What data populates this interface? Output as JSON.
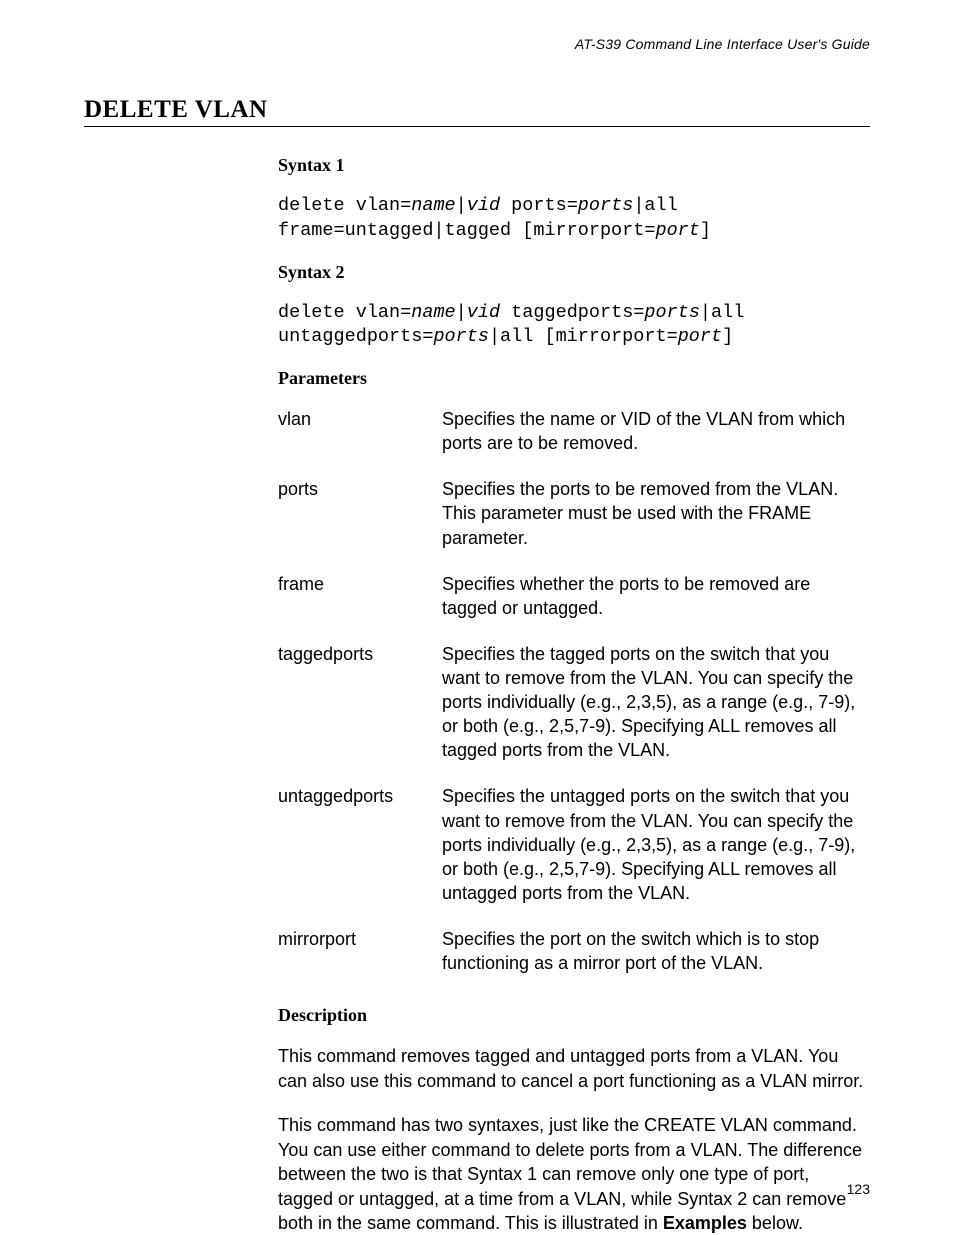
{
  "running_head": "AT-S39 Command Line Interface User's Guide",
  "title": "DELETE VLAN",
  "sections": {
    "syntax1_head": "Syntax 1",
    "syntax2_head": "Syntax 2",
    "params_head": "Parameters",
    "desc_head": "Description"
  },
  "syntax1": {
    "l1a": "delete vlan=",
    "l1b": "name",
    "l1c": "|",
    "l1d": "vid",
    "l1e": " ports=",
    "l1f": "ports",
    "l1g": "|all",
    "l2a": "frame=untagged|tagged [mirrorport=",
    "l2b": "port",
    "l2c": "]"
  },
  "syntax2": {
    "l1a": "delete vlan=",
    "l1b": "name",
    "l1c": "|",
    "l1d": "vid",
    "l1e": " taggedports=",
    "l1f": "ports",
    "l1g": "|all",
    "l2a": "untaggedports=",
    "l2b": "ports",
    "l2c": "|all [mirrorport=",
    "l2d": "port",
    "l2e": "]"
  },
  "parameters": {
    "p0": {
      "name": "vlan",
      "desc": "Specifies the name or VID of the VLAN from which ports are to be removed."
    },
    "p1": {
      "name": "ports",
      "desc": "Specifies the ports to be removed from the VLAN. This parameter must be used with the FRAME parameter."
    },
    "p2": {
      "name": "frame",
      "desc": "Specifies whether the ports to be removed are tagged or untagged."
    },
    "p3": {
      "name": "taggedports",
      "desc": "Specifies the tagged ports on the switch that you want to remove from the VLAN. You can specify the ports individually (e.g., 2,3,5), as a range (e.g., 7-9), or both (e.g., 2,5,7-9). Specifying ALL removes all tagged ports from the VLAN."
    },
    "p4": {
      "name": "untaggedports",
      "desc": "Specifies the untagged ports on the switch that you want to remove from the VLAN. You can specify the ports individually (e.g., 2,3,5), as a range (e.g., 7-9), or both (e.g., 2,5,7-9). Specifying ALL removes all untagged ports from the VLAN."
    },
    "p5": {
      "name": "mirrorport",
      "desc": "Specifies the port on the switch which is to stop functioning as a mirror port of the VLAN."
    }
  },
  "description": {
    "para1": "This command removes tagged and untagged ports from a VLAN. You can also use this command to cancel a port functioning as a VLAN mirror.",
    "para2_a": "This command has two syntaxes, just like the CREATE VLAN command. You can use either command to delete ports from a VLAN. The difference between the two is that Syntax 1 can remove only one type of port, tagged or untagged, at a time from a VLAN, while Syntax 2 can remove both in the same command. This is illustrated in ",
    "para2_bold": "Examples",
    "para2_b": " below."
  },
  "page_number": "123"
}
